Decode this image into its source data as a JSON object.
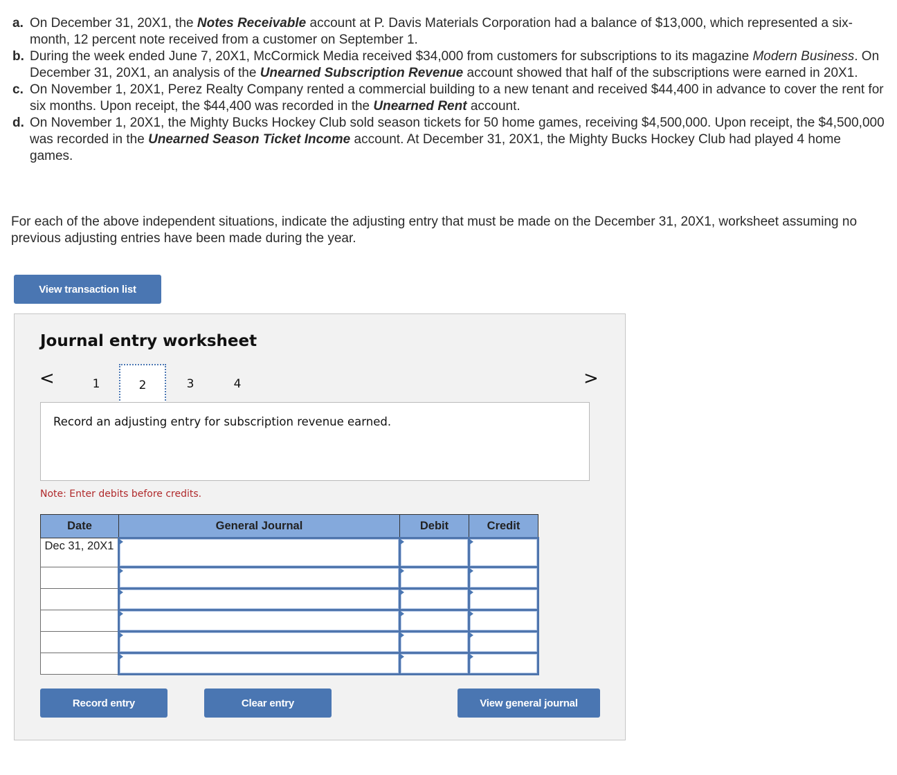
{
  "problems": [
    {
      "letter": "a.",
      "parts": [
        {
          "text": "On December 31, 20X1, the ",
          "style": "normal"
        },
        {
          "text": "Notes Receivable",
          "style": "bold-italic"
        },
        {
          "text": " account at P. Davis Materials Corporation had a balance of $13,000, which represented a six-month, 12 percent note received from a customer on September 1.",
          "style": "normal"
        }
      ]
    },
    {
      "letter": "b.",
      "parts": [
        {
          "text": "During the week ended June 7, 20X1, McCormick Media received $34,000 from customers for subscriptions to its magazine ",
          "style": "normal"
        },
        {
          "text": "Modern Business",
          "style": "italic"
        },
        {
          "text": ". On December 31, 20X1, an analysis of the ",
          "style": "normal"
        },
        {
          "text": "Unearned Subscription Revenue",
          "style": "bold-italic"
        },
        {
          "text": " account showed that half of the subscriptions were earned in 20X1.",
          "style": "normal"
        }
      ]
    },
    {
      "letter": "c.",
      "parts": [
        {
          "text": "On November 1, 20X1, Perez Realty Company rented a commercial building to a new tenant and received $44,400 in advance to cover the rent for six months. Upon receipt, the $44,400 was recorded in the ",
          "style": "normal"
        },
        {
          "text": "Unearned Rent",
          "style": "bold-italic"
        },
        {
          "text": " account.",
          "style": "normal"
        }
      ]
    },
    {
      "letter": "d.",
      "parts": [
        {
          "text": "On November 1, 20X1, the Mighty Bucks Hockey Club sold season tickets for 50 home games, receiving $4,500,000. Upon receipt, the $4,500,000 was recorded in the ",
          "style": "normal"
        },
        {
          "text": "Unearned Season Ticket Income",
          "style": "bold-italic"
        },
        {
          "text": " account. At December 31, 20X1, the Mighty Bucks Hockey Club had played 4 home games.",
          "style": "normal"
        }
      ]
    }
  ],
  "instructions": "For each of the above independent situations, indicate the adjusting entry that must be made on the December 31, 20X1, worksheet assuming no previous adjusting entries have been made during the year.",
  "buttons": {
    "view_transaction_list": "View transaction list",
    "record_entry": "Record entry",
    "clear_entry": "Clear entry",
    "view_general_journal": "View general journal"
  },
  "worksheet": {
    "title": "Journal entry worksheet",
    "pager": {
      "prev_icon": "<",
      "next_icon": ">",
      "pages": [
        "1",
        "2",
        "3",
        "4"
      ],
      "active_page": "2"
    },
    "prompt": "Record an adjusting entry for subscription revenue earned.",
    "note": "Note: Enter debits before credits.",
    "table": {
      "headers": {
        "date": "Date",
        "account": "General Journal",
        "debit": "Debit",
        "credit": "Credit"
      },
      "rows": [
        {
          "date": "Dec 31, 20X1",
          "account": "",
          "debit": "",
          "credit": ""
        },
        {
          "date": "",
          "account": "",
          "debit": "",
          "credit": ""
        },
        {
          "date": "",
          "account": "",
          "debit": "",
          "credit": ""
        },
        {
          "date": "",
          "account": "",
          "debit": "",
          "credit": ""
        },
        {
          "date": "",
          "account": "",
          "debit": "",
          "credit": ""
        },
        {
          "date": "",
          "account": "",
          "debit": "",
          "credit": ""
        }
      ]
    }
  },
  "colors": {
    "button_bg": "#4a76b2",
    "header_bg": "#84a9dc",
    "note_color": "#b0292b",
    "panel_bg": "#f2f2f2"
  }
}
